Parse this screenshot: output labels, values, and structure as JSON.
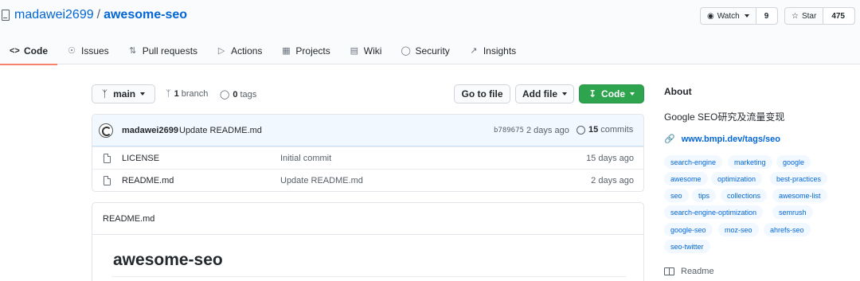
{
  "repo": {
    "owner": "madawei2699",
    "separator": "/",
    "name": "awesome-seo"
  },
  "header_actions": {
    "watch": {
      "label": "Watch",
      "count": "9",
      "icon": "eye-icon"
    },
    "star": {
      "label": "Star",
      "count": "475",
      "icon": "star-icon"
    }
  },
  "tabs": [
    {
      "label": "Code",
      "icon": "code-icon",
      "active": true
    },
    {
      "label": "Issues",
      "icon": "issue-icon"
    },
    {
      "label": "Pull requests",
      "icon": "pull-request-icon"
    },
    {
      "label": "Actions",
      "icon": "play-icon"
    },
    {
      "label": "Projects",
      "icon": "project-icon"
    },
    {
      "label": "Wiki",
      "icon": "book-icon"
    },
    {
      "label": "Security",
      "icon": "shield-icon"
    },
    {
      "label": "Insights",
      "icon": "graph-icon"
    }
  ],
  "toolbar": {
    "branch": "main",
    "branches_count": "1",
    "branches_label": "branch",
    "tags_count": "0",
    "tags_label": "tags",
    "go_to_file": "Go to file",
    "add_file": "Add file",
    "code": "Code"
  },
  "latest_commit": {
    "author": "madawei2699",
    "message": "Update README.md",
    "hash": "b789675",
    "ago": "2 days ago",
    "commits_count": "15",
    "commits_label": "commits"
  },
  "files": [
    {
      "name": "LICENSE",
      "commit": "Initial commit",
      "age": "15 days ago"
    },
    {
      "name": "README.md",
      "commit": "Update README.md",
      "age": "2 days ago"
    }
  ],
  "readme": {
    "filename": "README.md",
    "heading": "awesome-seo"
  },
  "about": {
    "title": "About",
    "description": "Google SEO研究及流量变现",
    "link": "www.bmpi.dev/tags/seo",
    "topics": [
      "search-engine",
      "marketing",
      "google",
      "awesome",
      "optimization",
      "best-practices",
      "seo",
      "tips",
      "collections",
      "awesome-list",
      "search-engine-optimization",
      "semrush",
      "google-seo",
      "moz-seo",
      "ahrefs-seo",
      "seo-twitter"
    ],
    "readme_label": "Readme"
  },
  "colors": {
    "accent": "#0366d6",
    "green": "#2ea44f",
    "tab_underline": "#f9826c",
    "topic_bg": "#f1f8ff"
  }
}
